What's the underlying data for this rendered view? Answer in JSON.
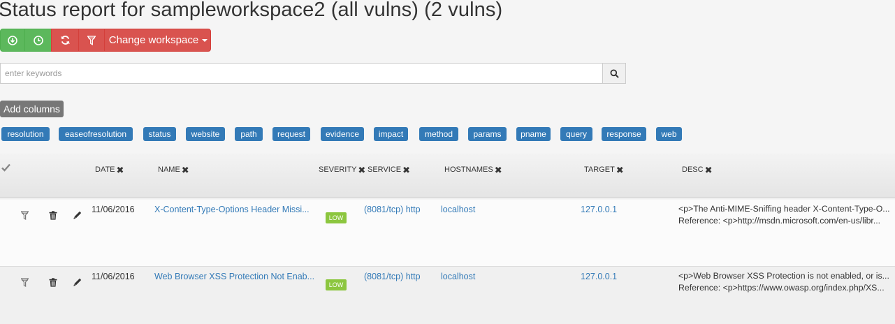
{
  "page": {
    "title": "Status report for sampleworkspace2 (all vulns) (2 vulns)"
  },
  "toolbar": {
    "download_icon": "download-circle-icon",
    "history_icon": "clock-icon",
    "refresh_icon": "refresh-icon",
    "filter_icon": "filter-icon",
    "change_workspace_label": "Change workspace",
    "colors": {
      "green": "#5cb85c",
      "red": "#d9534f"
    }
  },
  "search": {
    "placeholder": "enter keywords",
    "value": ""
  },
  "add_columns": {
    "label": "Add columns",
    "tags": [
      "resolution",
      "easeofresolution",
      "status",
      "website",
      "path",
      "request",
      "evidence",
      "impact",
      "method",
      "params",
      "pname",
      "query",
      "response",
      "web"
    ]
  },
  "table": {
    "headers": {
      "date": "DATE",
      "name": "NAME",
      "severity": "SEVERITY",
      "service": "SERVICE",
      "hostnames": "HOSTNAMES",
      "target": "TARGET",
      "desc": "DESC"
    },
    "rows": [
      {
        "date": "11/06/2016",
        "name": "X-Content-Type-Options Header Missi...",
        "severity": "LOW",
        "service": "(8081/tcp) http",
        "hostnames": "localhost",
        "target": "127.0.0.1",
        "desc_line1": "<p>The Anti-MIME-Sniffing header X-Content-Type-O...",
        "desc_line2": "Reference: <p>http://msdn.microsoft.com/en-us/libr..."
      },
      {
        "date": "11/06/2016",
        "name": "Web Browser XSS Protection Not Enab...",
        "severity": "LOW",
        "service": "(8081/tcp) http",
        "hostnames": "localhost",
        "target": "127.0.0.1",
        "desc_line1": "<p>Web Browser XSS Protection is not enabled, or is...",
        "desc_line2": "Reference: <p>https://www.owasp.org/index.php/XS..."
      }
    ]
  }
}
